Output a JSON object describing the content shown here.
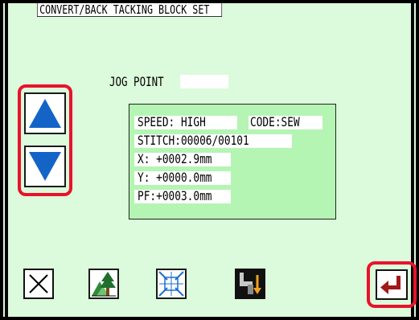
{
  "header": {
    "title": "CONVERT/BACK TACKING BLOCK SET"
  },
  "jog": {
    "label": "JOG POINT",
    "value": ""
  },
  "info": {
    "speed_label": "SPEED: HIGH",
    "code_label": "CODE:SEW",
    "stitch_label": "STITCH:00006/00101",
    "x_label": "X:  +0002.9mm",
    "y_label": "Y:  +0000.0mm",
    "pf_label": "PF:+0003.0mm"
  },
  "icons": {
    "up": "up-arrow-icon",
    "down": "down-arrow-icon",
    "cancel": "close-icon",
    "tree": "tree-pattern-icon",
    "center": "center-zoom-icon",
    "machine": "machine-feed-icon",
    "enter": "enter-icon"
  },
  "colors": {
    "screen_bg": "#dcfadc",
    "info_bg": "#b4f5b4",
    "arrow_blue": "#1464c8",
    "highlight_red": "#e8132b",
    "enter_red": "#a01818"
  }
}
